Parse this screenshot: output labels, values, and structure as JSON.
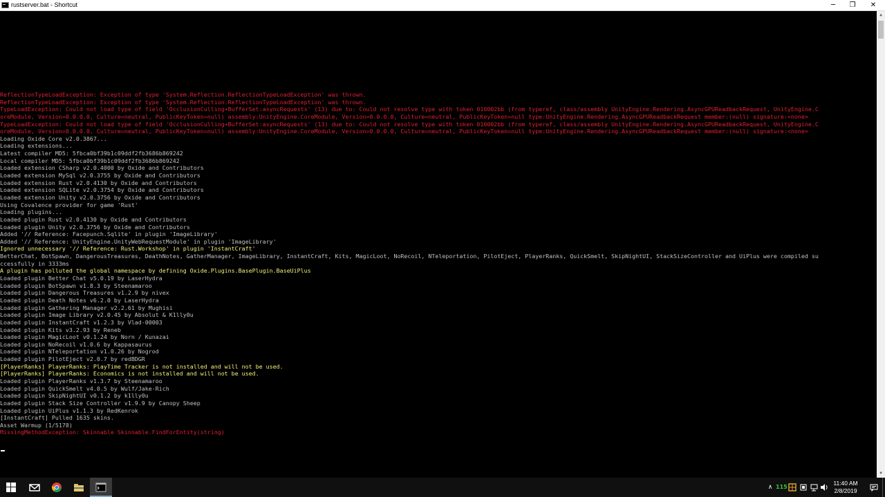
{
  "window": {
    "title": "rustserver.bat - Shortcut",
    "minimize_glyph": "─",
    "maximize_glyph": "❐",
    "close_glyph": "✕"
  },
  "console": {
    "lines": [
      {
        "text": "ReflectionTypeLoadException: Exception of type 'System.Reflection.ReflectionTypeLoadException' was thrown.",
        "color": "red"
      },
      {
        "text": "ReflectionTypeLoadException: Exception of type 'System.Reflection.ReflectionTypeLoadException' was thrown.",
        "color": "red"
      },
      {
        "text": "TypeLoadException: Could not load type of field 'OcclusionCulling+BufferSet:asyncRequests' (13) due to: Could not resolve type with token 010002bb (from typeref, class/assembly UnityEngine.Rendering.AsyncGPUReadbackRequest, UnityEngine.C",
        "color": "red"
      },
      {
        "text": "oreModule, Version=0.0.0.0, Culture=neutral, PublicKeyToken=null) assembly:UnityEngine.CoreModule, Version=0.0.0.0, Culture=neutral, PublicKeyToken=null type:UnityEngine.Rendering.AsyncGPUReadbackRequest member:(null) signature:<none>",
        "color": "red"
      },
      {
        "text": "TypeLoadException: Could not load type of field 'OcclusionCulling+BufferSet:asyncRequests' (13) due to: Could not resolve type with token 010002bb (from typeref, class/assembly UnityEngine.Rendering.AsyncGPUReadbackRequest, UnityEngine.C",
        "color": "red"
      },
      {
        "text": "oreModule, Version=0.0.0.0, Culture=neutral, PublicKeyToken=null) assembly:UnityEngine.CoreModule, Version=0.0.0.0, Culture=neutral, PublicKeyToken=null type:UnityEngine.Rendering.AsyncGPUReadbackRequest member:(null) signature:<none>",
        "color": "red"
      },
      {
        "text": "Loading Oxide Core v2.0.3867...",
        "color": "gray"
      },
      {
        "text": "Loading extensions...",
        "color": "gray"
      },
      {
        "text": "Latest compiler MD5: 5fbca0bf39b1c09ddf2fb3686b869242",
        "color": "gray"
      },
      {
        "text": "Local compiler MD5: 5fbca0bf39b1c09ddf2fb3686b869242",
        "color": "gray"
      },
      {
        "text": "Loaded extension CSharp v2.0.4000 by Oxide and Contributors",
        "color": "gray"
      },
      {
        "text": "Loaded extension MySql v2.0.3755 by Oxide and Contributors",
        "color": "gray"
      },
      {
        "text": "Loaded extension Rust v2.0.4130 by Oxide and Contributors",
        "color": "gray"
      },
      {
        "text": "Loaded extension SQLite v2.0.3754 by Oxide and Contributors",
        "color": "gray"
      },
      {
        "text": "Loaded extension Unity v2.0.3756 by Oxide and Contributors",
        "color": "gray"
      },
      {
        "text": "Using Covalence provider for game 'Rust'",
        "color": "gray"
      },
      {
        "text": "Loading plugins...",
        "color": "gray"
      },
      {
        "text": "Loaded plugin Rust v2.0.4130 by Oxide and Contributors",
        "color": "gray"
      },
      {
        "text": "Loaded plugin Unity v2.0.3756 by Oxide and Contributors",
        "color": "gray"
      },
      {
        "text": "Added '// Reference: Facepunch.Sqlite' in plugin 'ImageLibrary'",
        "color": "gray"
      },
      {
        "text": "Added '// Reference: UnityEngine.UnityWebRequestModule' in plugin 'ImageLibrary'",
        "color": "gray"
      },
      {
        "text": "Ignored unnecessary '// Reference: Rust.Workshop' in plugin 'InstantCraft'",
        "color": "yellow"
      },
      {
        "text": "BetterChat, BotSpawn, DangerousTreasures, DeathNotes, GatherManager, ImageLibrary, InstantCraft, Kits, MagicLoot, NoRecoil, NTeleportation, PilotEject, PlayerRanks, QuickSmelt, SkipNightUI, StackSizeController and UiPlus were compiled su",
        "color": "gray"
      },
      {
        "text": "ccessfully in 3333ms",
        "color": "gray"
      },
      {
        "text": "A plugin has polluted the global namespace by defining Oxide.Plugins.BasePlugin.BaseUiPlus",
        "color": "yellow"
      },
      {
        "text": "Loaded plugin Better Chat v5.0.19 by LaserHydra",
        "color": "gray"
      },
      {
        "text": "Loaded plugin BotSpawn v1.8.3 by Steenamaroo",
        "color": "gray"
      },
      {
        "text": "Loaded plugin Dangerous Treasures v1.2.9 by nivex",
        "color": "gray"
      },
      {
        "text": "Loaded plugin Death Notes v6.2.0 by LaserHydra",
        "color": "gray"
      },
      {
        "text": "Loaded plugin Gathering Manager v2.2.61 by Mughisi",
        "color": "gray"
      },
      {
        "text": "Loaded plugin Image Library v2.0.45 by Absolut & K1lly0u",
        "color": "gray"
      },
      {
        "text": "Loaded plugin InstantCraft v1.2.3 by Vlad-00003",
        "color": "gray"
      },
      {
        "text": "Loaded plugin Kits v3.2.93 by Reneb",
        "color": "gray"
      },
      {
        "text": "Loaded plugin MagicLoot v0.1.24 by Norn / Kunazai",
        "color": "gray"
      },
      {
        "text": "Loaded plugin NoRecoil v1.0.6 by Kappasaurus",
        "color": "gray"
      },
      {
        "text": "Loaded plugin NTeleportation v1.0.26 by Nogrod",
        "color": "gray"
      },
      {
        "text": "Loaded plugin PilotEject v2.0.7 by redBDGR",
        "color": "gray"
      },
      {
        "text": "[PlayerRanks] PlayerRanks: PlayTime Tracker is not installed and will not be used.",
        "color": "yellow"
      },
      {
        "text": "[PlayerRanks] PlayerRanks: Economics is not installed and will not be used.",
        "color": "yellow"
      },
      {
        "text": "Loaded plugin PlayerRanks v1.3.7 by Steenamaroo",
        "color": "gray"
      },
      {
        "text": "Loaded plugin QuickSmelt v4.0.5 by Wulf/Jake-Rich",
        "color": "gray"
      },
      {
        "text": "Loaded plugin SkipNightUI v0.1.2 by k1lly0u",
        "color": "gray"
      },
      {
        "text": "Loaded plugin Stack Size Controller v1.9.9 by Canopy Sheep",
        "color": "gray"
      },
      {
        "text": "Loaded plugin UiPlus v1.1.3 by RedKenrok",
        "color": "gray"
      },
      {
        "text": "[InstantCraft] Pulled 1635 skins.",
        "color": "gray"
      },
      {
        "text": "Asset Warmup (1/5178)",
        "color": "gray"
      },
      {
        "text": "MissingMethodException: Skinnable Skinnable.FindForEntity(string)",
        "color": "red"
      }
    ]
  },
  "scrollbar": {
    "up_glyph": "▲",
    "down_glyph": "▼"
  },
  "taskbar": {
    "items": [
      {
        "name": "start-button-icon",
        "interactable": true
      },
      {
        "name": "mail-icon",
        "interactable": true
      },
      {
        "name": "chrome-icon",
        "interactable": true
      },
      {
        "name": "file-explorer-icon",
        "interactable": true
      },
      {
        "name": "terminal-icon",
        "interactable": true,
        "active": true
      }
    ],
    "tray": {
      "chevron_glyph": "∧",
      "badge_text": "115",
      "clock_time": "11:40 AM",
      "clock_date": "2/8/2019"
    }
  }
}
